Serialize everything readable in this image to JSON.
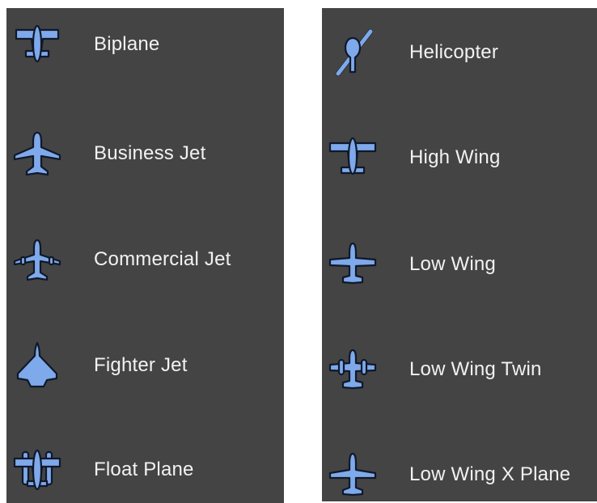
{
  "left_list": [
    {
      "label": "Biplane",
      "icon": "biplane-icon"
    },
    {
      "label": "Business Jet",
      "icon": "business-jet-icon"
    },
    {
      "label": "Commercial Jet",
      "icon": "commercial-jet-icon"
    },
    {
      "label": "Fighter Jet",
      "icon": "fighter-jet-icon"
    },
    {
      "label": "Float Plane",
      "icon": "float-plane-icon"
    }
  ],
  "right_list": [
    {
      "label": "Helicopter",
      "icon": "helicopter-icon"
    },
    {
      "label": "High Wing",
      "icon": "high-wing-icon"
    },
    {
      "label": "Low Wing",
      "icon": "low-wing-icon"
    },
    {
      "label": "Low Wing Twin",
      "icon": "low-wing-twin-icon"
    },
    {
      "label": "Low Wing X Plane",
      "icon": "low-wing-x-plane-icon"
    }
  ],
  "colors": {
    "panel_bg": "#444444",
    "icon_fill": "#7ea9ea",
    "text": "#f2f2f2"
  }
}
